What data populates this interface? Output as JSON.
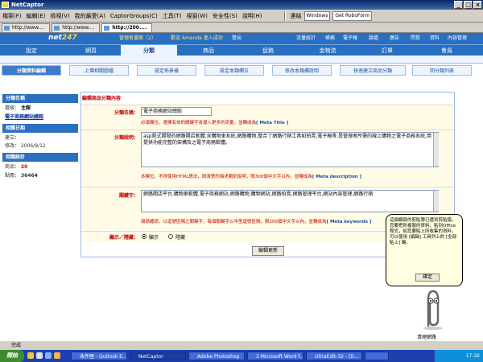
{
  "window": {
    "title": "NetCaptor",
    "min": "_",
    "max": "□",
    "close": "×"
  },
  "menubar": {
    "items": [
      "檔案(F)",
      "編輯(E)",
      "檢視(V)",
      "我的最愛(A)",
      "CaptorGroups(C)",
      "工具(T)",
      "視窗(W)",
      "安全性(S)",
      "說明(H)"
    ],
    "links_label": "連結",
    "links": [
      "Windows",
      "Get RoboForm"
    ]
  },
  "browser_tabs": [
    {
      "label": "http://www...."
    },
    {
      "label": "http://www...."
    },
    {
      "label": "http://200...."
    }
  ],
  "site": {
    "logo_main": "net",
    "logo_accent": "247",
    "admin_label": "管理者畫面（2）",
    "welcome": "歡迎 Amanda 進入成功",
    "logout": "登出",
    "top_links": [
      "流量統計",
      "帳務",
      "電子報",
      "論壇",
      "廣告",
      "問卷",
      "資料",
      "內容管理"
    ]
  },
  "nav": {
    "items": [
      "設定",
      "網頁",
      "分類",
      "商品",
      "促銷",
      "金物流",
      "訂單",
      "會員"
    ],
    "active": "分類"
  },
  "subtabs": [
    "分類資料編輯",
    "上傳相關圖檔",
    "設定佈景樣",
    "設定本類欄位",
    "修改本類欄說明",
    "快速建立商品分類",
    "回分類列表"
  ],
  "sidebar": {
    "name_header": "分類名稱",
    "level_label": "層級：",
    "level_value": "主館",
    "category_link": "電子商務網站總館",
    "date_header": "相關日期",
    "created_label": "建立：",
    "modified_label": "修改：",
    "modified_value": "2006/9/12",
    "stats_header": "相關統計",
    "products_label": "商品：",
    "products_value": "20",
    "clicks_label": "點閱：",
    "clicks_value": "36464"
  },
  "form": {
    "title": "編輯商品分類內容",
    "name_label": "分類名稱：",
    "name_value": "電子商務網站總館",
    "name_hint": "必填欄位，選擇有效的關鍵字會導入更多的流量，並轉成為",
    "name_hint_tag": "[ Meta Title ]",
    "desc_label": "分類說明：",
    "desc_value": "asp程式開發的網路開店軟體,含購物車系統,網路購物,整合了網路行銷工具如拍賣,電子報等,是管理者所需的線上購物之電子商務系統,用提供功能完整的架構及之電子商務軟體。",
    "desc_hint": "本欄位，不得使用HTML語法，請清楚的描述類別說明，限300個中文字以內，並轉成為",
    "desc_hint_tag": "[ Meta description ]",
    "kw_label": "關鍵字：",
    "kw_value": "網路開店平台,購物車軟體,電子商務網站,網路購物,購物網站,網路拍賣,網路管理平台,網站內容管理,網路行銷",
    "kw_hint": "總請確認，以逗號區隔之關鍵字，每個關鍵字以半型逗號區隔，限200個中文字以內，並轉成為",
    "kw_hint_tag": "[ Meta keywords ]",
    "visibility_label": "顯示／隱藏：",
    "show_label": "顯示",
    "hide_label": "隱藏",
    "submit_label": "編輯更新"
  },
  "assistant": {
    "text": "這個網頁的剪貼簿已遭到剪貼錯，您要把所複製的資料，貼到Office程式，如您要貼上所收集的資料，可以使用 [編輯] 工具列上的 [全部貼上] 鍵。",
    "ok_label": "確定",
    "status": "清理網路"
  },
  "statusbar": {
    "text": "完成"
  },
  "taskbar": {
    "start": "開始",
    "buttons": [
      "收件匣 - Outlook E...",
      "NetCaptor",
      "Adobe Photoshop",
      "3 Microsoft Word f...",
      "UltraEdit-32 - [D...",
      ""
    ],
    "clock": "17:32"
  }
}
